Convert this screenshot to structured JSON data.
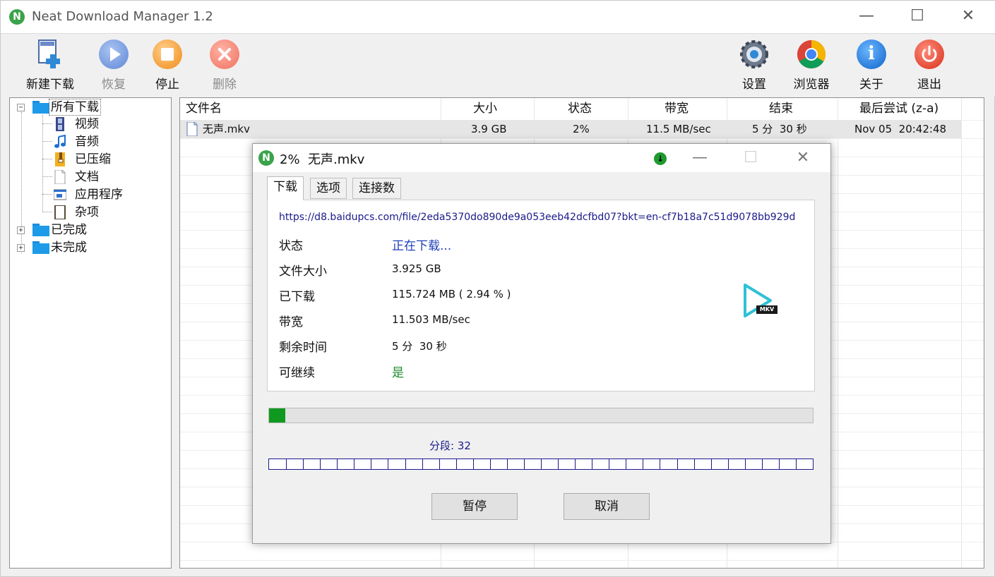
{
  "window": {
    "title": "Neat Download Manager 1.2",
    "controls": {
      "minimize": "—",
      "maximize": "☐",
      "close": "✕"
    }
  },
  "toolbar": {
    "new_download": "新建下载",
    "resume": "恢复",
    "stop": "停止",
    "delete": "删除",
    "settings": "设置",
    "browser": "浏览器",
    "about": "关于",
    "exit": "退出"
  },
  "tree": {
    "root": "所有下载",
    "children": [
      "视频",
      "音频",
      "已压缩",
      "文档",
      "应用程序",
      "杂项"
    ],
    "completed": "已完成",
    "incomplete": "未完成"
  },
  "list": {
    "columns": {
      "filename": "文件名",
      "size": "大小",
      "status": "状态",
      "bandwidth": "带宽",
      "end": "结束",
      "last_try": "最后尝试 (z-a)"
    },
    "rows": [
      {
        "filename": "无声.mkv",
        "size": "3.9 GB",
        "status": "2%",
        "bandwidth": "11.5 MB/sec",
        "end": "5 分  30 秒",
        "last_try": "Nov 05  20:42:48"
      }
    ]
  },
  "dialog": {
    "title": "2%  无声.mkv",
    "controls": {
      "minimize": "—",
      "maximize": "☐",
      "close": "✕"
    },
    "tabs": [
      "下载",
      "选项",
      "连接数"
    ],
    "url": "https://d8.baidupcs.com/file/2eda5370do890de9a053eeb42dcfbd07?bkt=en-cf7b18a7c51d9078bb929d",
    "fields": {
      "status_label": "状态",
      "status_value": "正在下载...",
      "size_label": "文件大小",
      "size_value": "3.925 GB",
      "downloaded_label": "已下载",
      "downloaded_value": "115.724 MB ( 2.94 % )",
      "bandwidth_label": "带宽",
      "bandwidth_value": "11.503 MB/sec",
      "remaining_label": "剩余时间",
      "remaining_value": "5 分  30 秒",
      "resumable_label": "可继续",
      "resumable_value": "是"
    },
    "file_type_badge": "MKV",
    "progress_percent": 2.94,
    "segments_label": "分段: 32",
    "segments_count": 32,
    "pause_button": "暂停",
    "cancel_button": "取消"
  },
  "colors": {
    "progress": "#0f9a1f",
    "segment": "#1a1a8a",
    "status_blue": "#1f3fb8",
    "yes_green": "#1c8a2c",
    "folder": "#1e9be8"
  }
}
